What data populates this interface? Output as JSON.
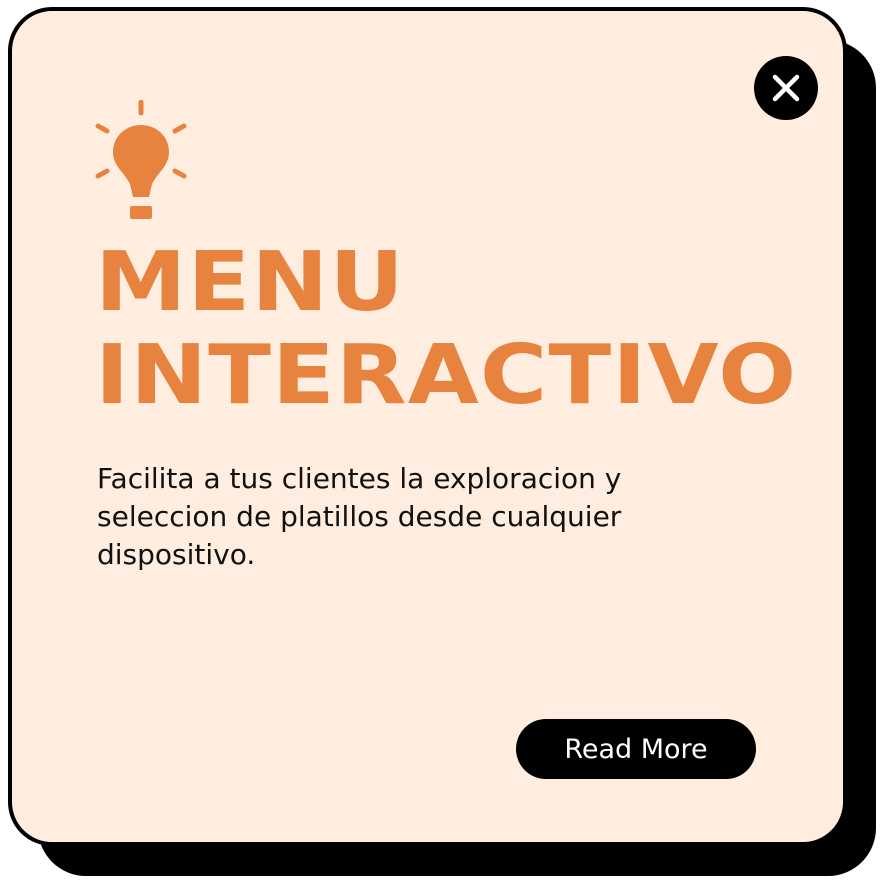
{
  "colors": {
    "accent": "#E8833F",
    "card_background": "#FFEEDF",
    "outline": "#000000",
    "button_text": "#FFFFFF"
  },
  "icons": {
    "close": "close-icon",
    "bulb": "lightbulb-icon"
  },
  "card": {
    "title_line1": "MENU",
    "title_line2": "INTERACTIVO",
    "description": "Facilita a tus clientes la exploracion y seleccion de platillos desde cualquier dispositivo.",
    "read_more_label": "Read More"
  }
}
